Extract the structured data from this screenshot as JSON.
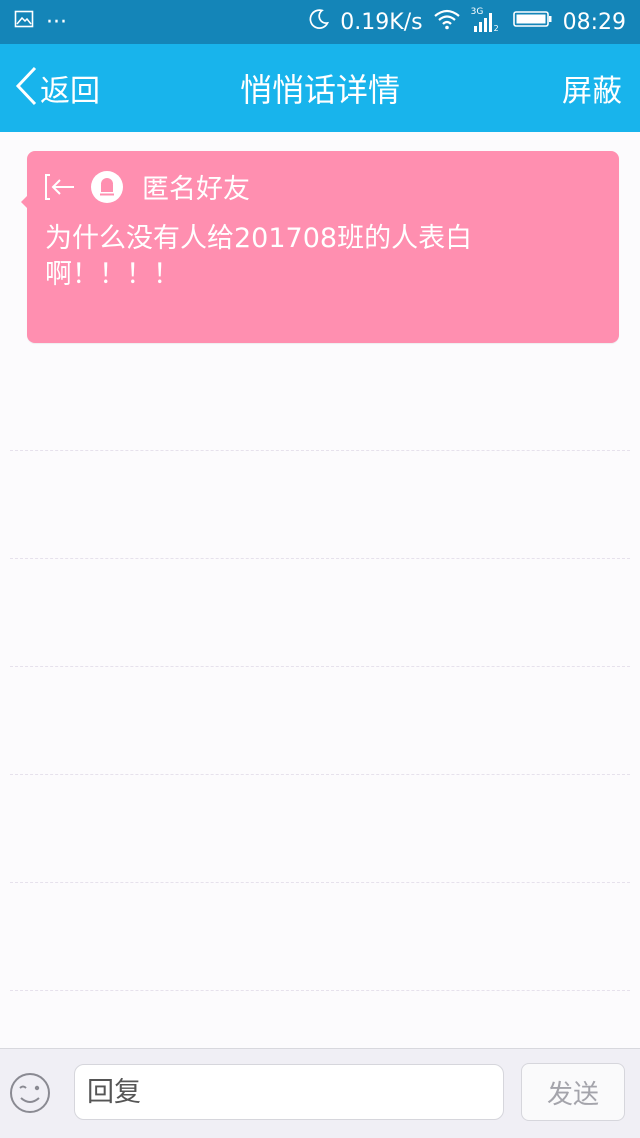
{
  "status_bar": {
    "more": "···",
    "net_speed": "0.19K/s",
    "network_type": "3G",
    "sim_slot": "2",
    "time": "08:29",
    "icons": [
      "image-notification-icon",
      "moon-icon",
      "wifi-icon",
      "signal-icon",
      "battery-icon"
    ]
  },
  "nav": {
    "back_label": "返回",
    "title": "悄悄话详情",
    "action_label": "屏蔽"
  },
  "message": {
    "sender": "匿名好友",
    "text": "为什么没有人给201708班的人表白啊！！！！",
    "icons": [
      "reply-arrow-icon",
      "anonymous-avatar-icon"
    ]
  },
  "composer": {
    "placeholder": "回复",
    "send_label": "发送",
    "icons": [
      "emoji-icon"
    ]
  },
  "colors": {
    "status_bar": "#1485b8",
    "nav_bar": "#18b4ec",
    "card": "#ff8fb0",
    "background": "#fcfbfd"
  }
}
